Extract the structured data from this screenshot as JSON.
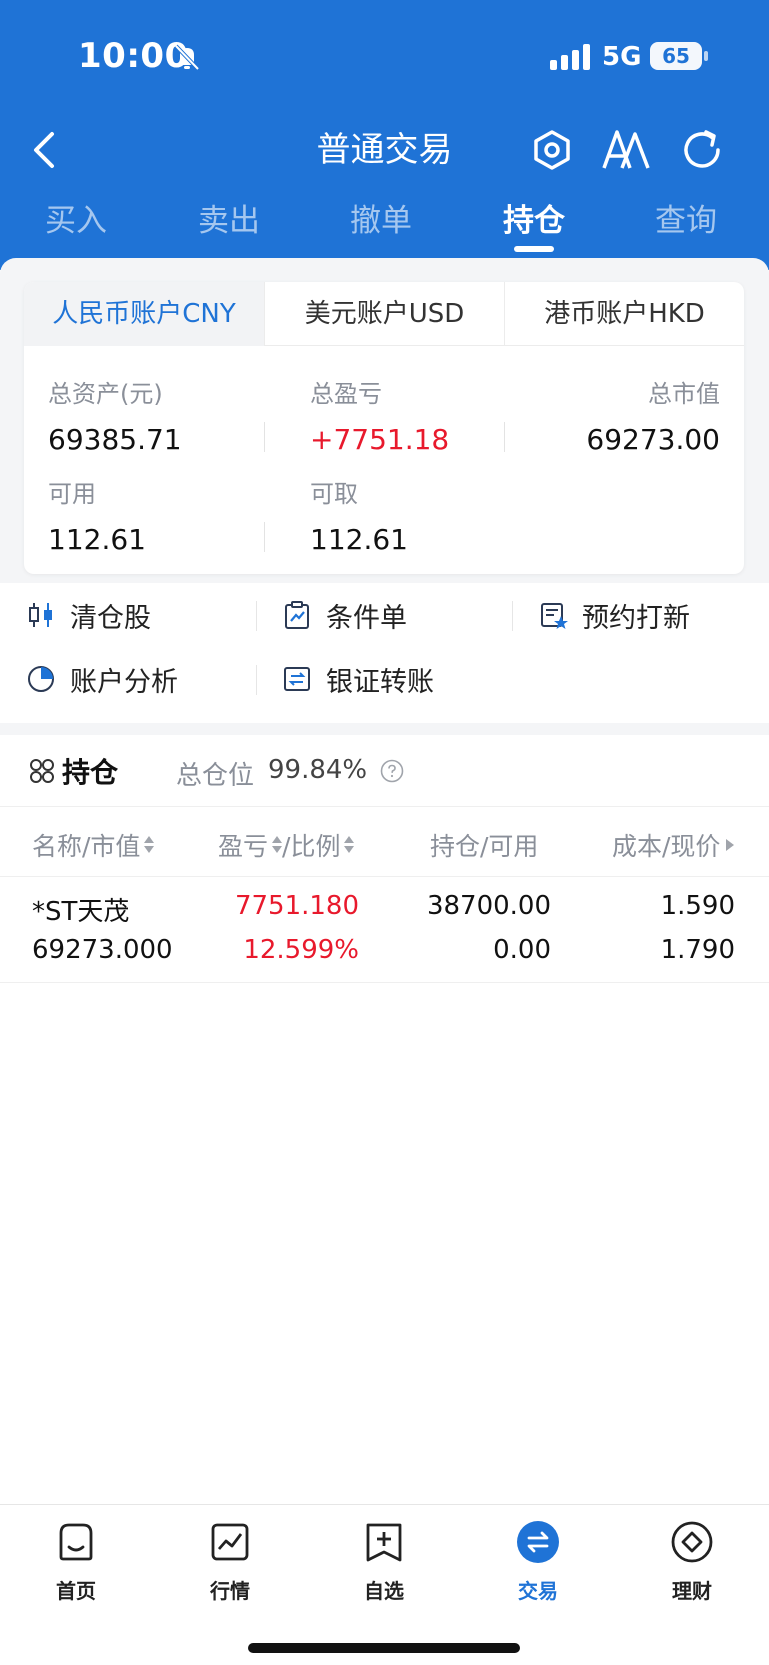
{
  "status_bar": {
    "time": "10:00",
    "network": "5G",
    "battery": "65"
  },
  "nav": {
    "title": "普通交易"
  },
  "tabs": [
    {
      "label": "买入"
    },
    {
      "label": "卖出"
    },
    {
      "label": "撤单"
    },
    {
      "label": "持仓",
      "active": true
    },
    {
      "label": "查询"
    }
  ],
  "accounts": {
    "tabs": [
      {
        "label": "人民币账户CNY",
        "active": true
      },
      {
        "label": "美元账户USD"
      },
      {
        "label": "港币账户HKD"
      }
    ],
    "total_assets_label": "总资产(元)",
    "total_assets": "69385.71",
    "total_pnl_label": "总盈亏",
    "total_pnl": "+7751.18",
    "market_value_label": "总市值",
    "market_value": "69273.00",
    "available_label": "可用",
    "available": "112.61",
    "withdrawable_label": "可取",
    "withdrawable": "112.61"
  },
  "quick_actions": [
    {
      "label": "清仓股",
      "icon": "candlestick-icon"
    },
    {
      "label": "条件单",
      "icon": "clipboard-chart-icon"
    },
    {
      "label": "预约打新",
      "icon": "reserve-ipo-icon"
    },
    {
      "label": "账户分析",
      "icon": "pie-chart-icon"
    },
    {
      "label": "银证转账",
      "icon": "transfer-icon"
    }
  ],
  "holdings": {
    "title": "持仓",
    "position_label": "总仓位",
    "position_value": "99.84%",
    "columns": {
      "name": "名称/市值",
      "pnl": "盈亏",
      "ratio": "/比例",
      "qty": "持仓/可用",
      "cost": "成本/现价"
    },
    "rows": [
      {
        "name": "*ST天茂",
        "market_value": "69273.000",
        "pnl": "7751.180",
        "pnl_ratio": "12.599%",
        "position": "38700.00",
        "available": "0.00",
        "cost": "1.590",
        "price": "1.790"
      }
    ]
  },
  "bottom_nav": [
    {
      "label": "首页",
      "icon": "home-icon"
    },
    {
      "label": "行情",
      "icon": "market-icon"
    },
    {
      "label": "自选",
      "icon": "watchlist-icon"
    },
    {
      "label": "交易",
      "icon": "trade-icon",
      "active": true
    },
    {
      "label": "理财",
      "icon": "wealth-icon"
    }
  ],
  "colors": {
    "brand": "#1f73d6",
    "profit": "#e8192c"
  }
}
